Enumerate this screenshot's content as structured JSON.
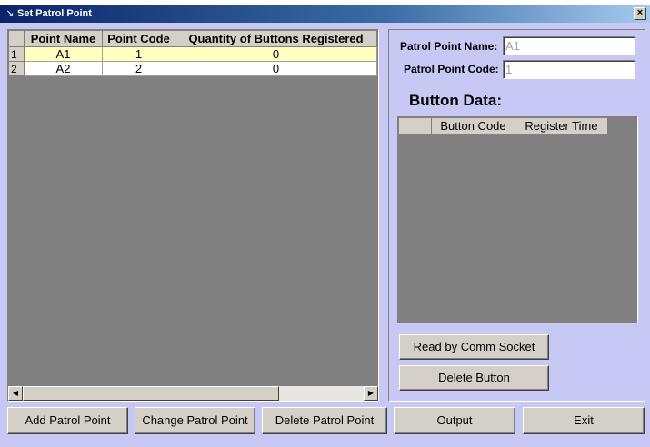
{
  "window": {
    "title": "Set Patrol Point",
    "close_label": "×"
  },
  "grid": {
    "columns": [
      "Point Name",
      "Point Code",
      "Quantity of Buttons Registered"
    ],
    "rows": [
      {
        "num": "1",
        "point_name": "A1",
        "point_code": "1",
        "quantity": "0"
      },
      {
        "num": "2",
        "point_name": "A2",
        "point_code": "2",
        "quantity": "0"
      }
    ]
  },
  "form": {
    "patrol_point_name_label": "Patrol Point Name:",
    "patrol_point_name_value": "A1",
    "patrol_point_code_label": "Patrol Point Code:",
    "patrol_point_code_value": "1"
  },
  "button_data": {
    "title": "Button Data:",
    "columns": [
      "Button Code",
      "Register Time"
    ]
  },
  "panel_buttons": {
    "read": "Read by Comm Socket",
    "delete": "Delete Button"
  },
  "bottom_buttons": {
    "add": "Add Patrol Point",
    "change": "Change Patrol Point",
    "delete": "Delete Patrol Point",
    "output": "Output",
    "exit": "Exit"
  }
}
